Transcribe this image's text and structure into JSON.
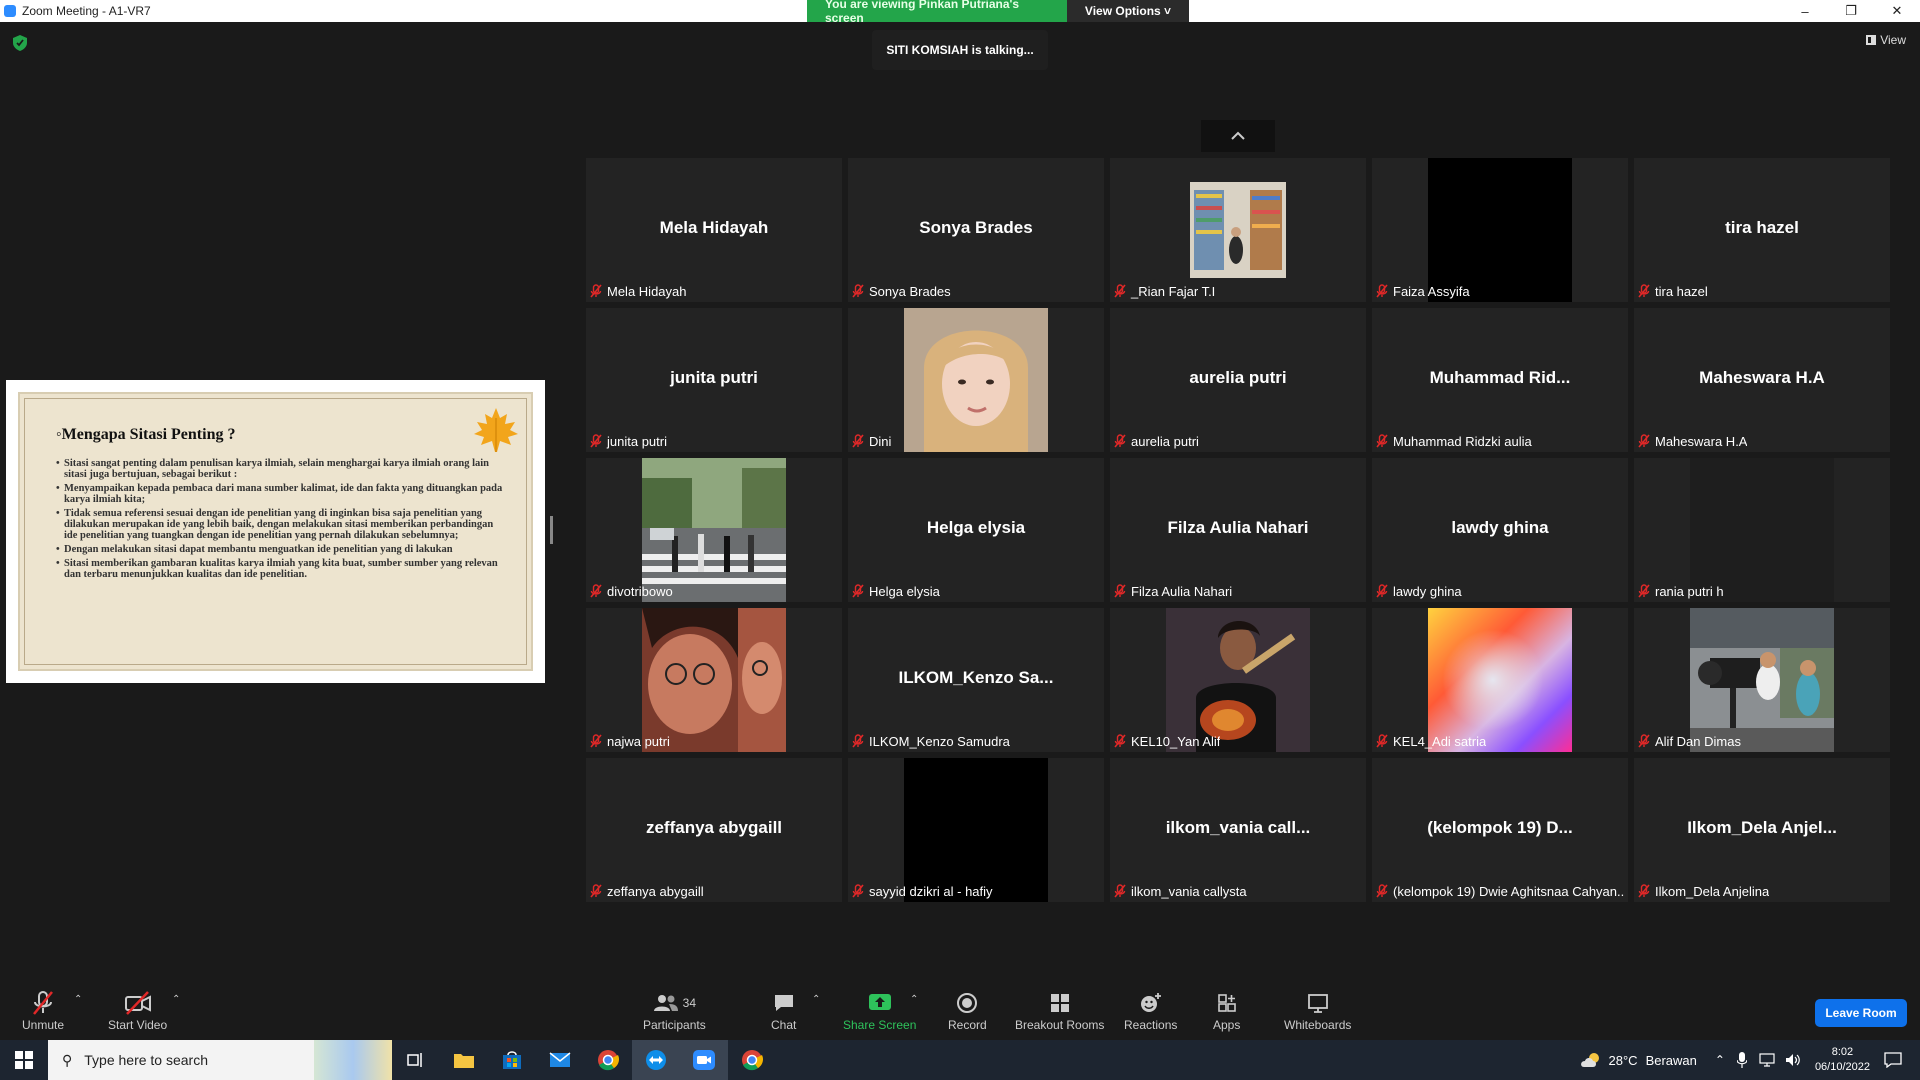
{
  "window": {
    "title": "Zoom Meeting - A1-VR7",
    "controls": {
      "minimize": "–",
      "maximize": "❐",
      "close": "✕"
    }
  },
  "share_banner": {
    "viewing": "You are viewing Pinkan Putriana's screen",
    "view_options": "View Options ˅"
  },
  "talking_indicator": "SITI KOMSIAH is talking...",
  "view_button": "View",
  "slide": {
    "title": "Mengapa Sitasi Penting ?",
    "bullets": [
      "Sitasi sangat penting dalam penulisan karya ilmiah, selain menghargai karya ilmiah orang lain sitasi juga bertujuan, sebagai berikut :",
      "Menyampaikan kepada pembaca dari mana sumber kalimat, ide dan fakta yang dituangkan pada karya ilmiah kita;",
      "Tidak semua referensi sesuai dengan ide penelitian yang di inginkan bisa saja penelitian yang dilakukan merupakan ide yang lebih baik, dengan melakukan sitasi memberikan perbandingan ide penelitian yang tuangkan dengan ide penelitian yang pernah dilakukan sebelumnya;",
      "Dengan melakukan sitasi dapat membantu menguatkan ide penelitian yang di lakukan",
      "Sitasi memberikan gambaran kualitas karya ilmiah yang kita buat, sumber sumber yang relevan dan terbaru menunjukkan kualitas dan ide penelitian."
    ]
  },
  "participants": [
    {
      "display": "Mela Hidayah",
      "label": "Mela Hidayah",
      "video": null
    },
    {
      "display": "Sonya Brades",
      "label": "Sonya Brades",
      "video": null
    },
    {
      "display": "",
      "label": "_Rian Fajar T.I",
      "video": "library"
    },
    {
      "display": "",
      "label": "Faiza Assyifa",
      "video": "black"
    },
    {
      "display": "tira hazel",
      "label": "tira hazel",
      "video": null
    },
    {
      "display": "junita putri",
      "label": "junita putri",
      "video": null
    },
    {
      "display": "",
      "label": "Dini",
      "video": "portrait"
    },
    {
      "display": "aurelia putri",
      "label": "aurelia putri",
      "video": null
    },
    {
      "display": "Muhammad  Rid...",
      "label": "Muhammad Ridzki aulia",
      "video": null
    },
    {
      "display": "Maheswara H.A",
      "label": "Maheswara H.A",
      "video": null
    },
    {
      "display": "",
      "label": "divotribowo",
      "video": "street"
    },
    {
      "display": "Helga elysia",
      "label": "Helga elysia",
      "video": null
    },
    {
      "display": "Filza Aulia Nahari",
      "label": "Filza Aulia Nahari",
      "video": null
    },
    {
      "display": "lawdy ghina",
      "label": "lawdy ghina",
      "video": null
    },
    {
      "display": "",
      "label": "rania putri h",
      "video": "dark"
    },
    {
      "display": "",
      "label": "najwa putri",
      "video": "selfie"
    },
    {
      "display": "ILKOM_Kenzo  Sa...",
      "label": "ILKOM_Kenzo Samudra",
      "video": null
    },
    {
      "display": "",
      "label": "KEL10_Yan Alif",
      "video": "guitar"
    },
    {
      "display": "",
      "label": "KEL4_Adi satria",
      "video": "gradient"
    },
    {
      "display": "",
      "label": "Alif Dan Dimas",
      "video": "camera"
    },
    {
      "display": "zeffanya abygaill",
      "label": "zeffanya abygaill",
      "video": null
    },
    {
      "display": "",
      "label": "sayyid dzikri al - hafiy",
      "video": "black"
    },
    {
      "display": "ilkom_vania  call...",
      "label": "ilkom_vania callysta",
      "video": null
    },
    {
      "display": "(kelompok 19)  D...",
      "label": "(kelompok 19) Dwie Aghitsnaa Cahyan...",
      "video": null
    },
    {
      "display": "Ilkom_Dela  Anjel...",
      "label": "Ilkom_Dela Anjelina",
      "video": null
    }
  ],
  "toolbar": {
    "unmute": "Unmute",
    "start_video": "Start Video",
    "participants": "Participants",
    "participants_count": "34",
    "chat": "Chat",
    "share_screen": "Share Screen",
    "record": "Record",
    "breakout_rooms": "Breakout Rooms",
    "reactions": "Reactions",
    "apps": "Apps",
    "whiteboards": "Whiteboards",
    "leave": "Leave Room"
  },
  "taskbar": {
    "search_placeholder": "Type here to search",
    "weather_temp": "28°C",
    "weather_desc": "Berawan",
    "time": "8:02",
    "date": "06/10/2022"
  },
  "colors": {
    "share_green": "#23a54a",
    "leave_blue": "#0e71eb",
    "muted_red": "#e02828",
    "tile_bg": "#232323"
  }
}
